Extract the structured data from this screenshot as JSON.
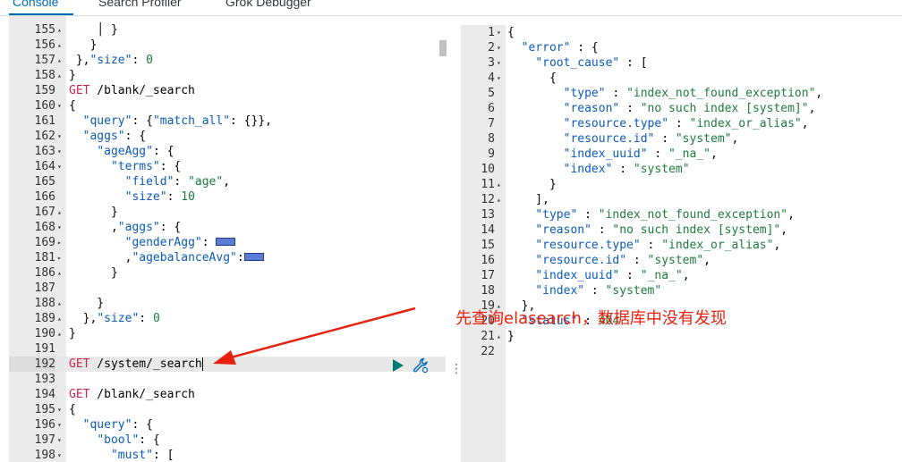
{
  "tabs": [
    {
      "label": "Console"
    },
    {
      "label": "Search Profiler"
    },
    {
      "label": "Grok Debugger"
    }
  ],
  "request_editor": {
    "lines": [
      {
        "n": "155",
        "fold": "▴",
        "code": "    │ }"
      },
      {
        "n": "156",
        "fold": "▴",
        "code": "   }"
      },
      {
        "n": "157",
        "fold": "▴",
        "code": " },\"size\": 0"
      },
      {
        "n": "158",
        "fold": "▴",
        "code": "}"
      },
      {
        "n": "159",
        "fold": "",
        "code": "GET /blank/_search"
      },
      {
        "n": "160",
        "fold": "▾",
        "code": "{"
      },
      {
        "n": "161",
        "fold": "",
        "code": "  \"query\": {\"match_all\": {}},"
      },
      {
        "n": "162",
        "fold": "▾",
        "code": "  \"aggs\": {"
      },
      {
        "n": "163",
        "fold": "▾",
        "code": "    \"ageAgg\": {"
      },
      {
        "n": "164",
        "fold": "▾",
        "code": "      \"terms\": {"
      },
      {
        "n": "165",
        "fold": "",
        "code": "        \"field\": \"age\","
      },
      {
        "n": "166",
        "fold": "",
        "code": "        \"size\": 10"
      },
      {
        "n": "167",
        "fold": "▴",
        "code": "      }"
      },
      {
        "n": "168",
        "fold": "▾",
        "code": "      ,\"aggs\": {"
      },
      {
        "n": "169",
        "fold": "▸",
        "code": "        \"genderAgg\": {FOLD}"
      },
      {
        "n": "181",
        "fold": "▸",
        "code": "        ,\"agebalanceAvg\":{FOLD}"
      },
      {
        "n": "186",
        "fold": "▴",
        "code": "      }"
      },
      {
        "n": "187",
        "fold": "",
        "code": ""
      },
      {
        "n": "188",
        "fold": "▴",
        "code": "    }"
      },
      {
        "n": "189",
        "fold": "▴",
        "code": "  },\"size\": 0"
      },
      {
        "n": "190",
        "fold": "▴",
        "code": "}"
      },
      {
        "n": "191",
        "fold": "",
        "code": ""
      },
      {
        "n": "192",
        "fold": "",
        "code": "GET /system/_search"
      },
      {
        "n": "193",
        "fold": "",
        "code": ""
      },
      {
        "n": "194",
        "fold": "",
        "code": "GET /blank/_search"
      },
      {
        "n": "195",
        "fold": "▾",
        "code": "{"
      },
      {
        "n": "196",
        "fold": "▾",
        "code": "  \"query\": {"
      },
      {
        "n": "197",
        "fold": "▾",
        "code": "    \"bool\": {"
      },
      {
        "n": "198",
        "fold": "▾",
        "code": "      \"must\": ["
      }
    ]
  },
  "response_viewer": {
    "lines": [
      {
        "n": "1",
        "fold": "▾",
        "code": "{"
      },
      {
        "n": "2",
        "fold": "▾",
        "code": "  \"error\" : {"
      },
      {
        "n": "3",
        "fold": "▾",
        "code": "    \"root_cause\" : ["
      },
      {
        "n": "4",
        "fold": "▾",
        "code": "      {"
      },
      {
        "n": "5",
        "fold": "",
        "code": "        \"type\" : \"index_not_found_exception\","
      },
      {
        "n": "6",
        "fold": "",
        "code": "        \"reason\" : \"no such index [system]\","
      },
      {
        "n": "7",
        "fold": "",
        "code": "        \"resource.type\" : \"index_or_alias\","
      },
      {
        "n": "8",
        "fold": "",
        "code": "        \"resource.id\" : \"system\","
      },
      {
        "n": "9",
        "fold": "",
        "code": "        \"index_uuid\" : \"_na_\","
      },
      {
        "n": "10",
        "fold": "",
        "code": "        \"index\" : \"system\""
      },
      {
        "n": "11",
        "fold": "▴",
        "code": "      }"
      },
      {
        "n": "12",
        "fold": "▴",
        "code": "    ],"
      },
      {
        "n": "13",
        "fold": "",
        "code": "    \"type\" : \"index_not_found_exception\","
      },
      {
        "n": "14",
        "fold": "",
        "code": "    \"reason\" : \"no such index [system]\","
      },
      {
        "n": "15",
        "fold": "",
        "code": "    \"resource.type\" : \"index_or_alias\","
      },
      {
        "n": "16",
        "fold": "",
        "code": "    \"resource.id\" : \"system\","
      },
      {
        "n": "17",
        "fold": "",
        "code": "    \"index_uuid\" : \"_na_\","
      },
      {
        "n": "18",
        "fold": "",
        "code": "    \"index\" : \"system\""
      },
      {
        "n": "19",
        "fold": "▴",
        "code": "  },"
      },
      {
        "n": "20",
        "fold": "",
        "code": "  \"status\" : 404"
      },
      {
        "n": "21",
        "fold": "▴",
        "code": "}"
      },
      {
        "n": "22",
        "fold": "",
        "code": ""
      }
    ]
  },
  "annotation": {
    "text": "先查询elasearch，数据库中没有发现"
  },
  "colors": {
    "accent": "#006bb8",
    "annotation_red": "#e8200e",
    "play_green": "#017d73"
  },
  "icons": {
    "run": "play-icon",
    "settings": "wrench-icon"
  }
}
